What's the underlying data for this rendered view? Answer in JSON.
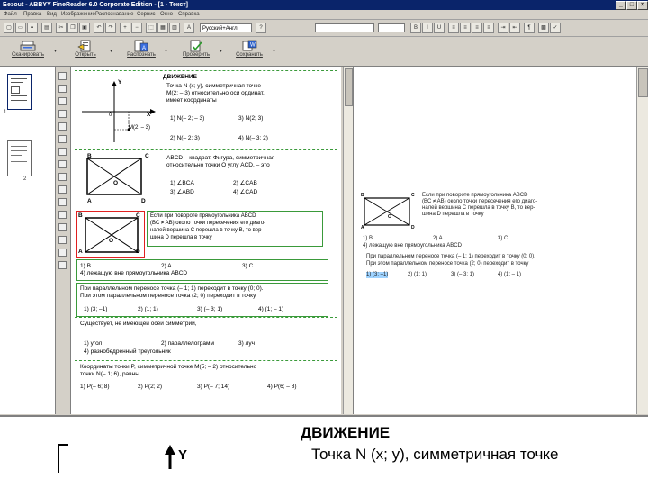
{
  "window": {
    "title": "Безout - ABBYY FineReader 6.0 Corporate Edition - [1 - Текст]",
    "min": "_",
    "max": "□",
    "close": "×"
  },
  "menu": [
    "Файл",
    "Правка",
    "Вид",
    "Изображение",
    "Распознавание",
    "Сервис",
    "Окно",
    "Справка"
  ],
  "toolbar": {
    "style_combo": "Русский+Англ.",
    "font_combo": "",
    "size_combo": "",
    "pilcrow": "¶"
  },
  "bigbuttons": [
    {
      "label": "Сканировать"
    },
    {
      "label": "Открыть"
    },
    {
      "label": "Распознать"
    },
    {
      "label": "Проверить"
    },
    {
      "label": "Сохранить"
    }
  ],
  "thumbs": [
    {
      "num": "1"
    },
    {
      "num": "2"
    }
  ],
  "image": {
    "heading": "ДВИЖЕНИЕ",
    "q1_line1": "Точка N (x; y), симметричная точке",
    "q1_line2": "M(2; – 3) относительно оси ординат,",
    "q1_line3": "имеет координаты",
    "q1_a1": "1) N(– 2; – 3)",
    "q1_a2": "3) N(2; 3)",
    "q1_a3": "2) N(– 2; 3)",
    "q1_a4": "4) N(– 3; 2)",
    "axis_y": "Y",
    "axis_x": "X",
    "m_label": "M(2; – 3)",
    "zero": "0",
    "q2_line1": "ABCD – квадрат. Фигура, симметричная",
    "q2_line2": "относительно точки О углу ACD, – это",
    "q2_a1": "1) ∠BCA",
    "q2_a2": "2) ∠CAB",
    "q2_a3": "3) ∠ABD",
    "q2_a4": "4) ∠CAD",
    "pt_A": "A",
    "pt_B": "B",
    "pt_C": "C",
    "pt_D": "D",
    "pt_O": "O",
    "q3_line1": "Если при повороте прямоугольника ABCD",
    "q3_line2": "(BC ≠ AB) около точки пересечения его диаго-",
    "q3_line3": "налей вершина C перешла в точку B, то вер-",
    "q3_line4": "шина D перешла в точку",
    "q3_a1": "1) B",
    "q3_a2": "2) A",
    "q3_a3": "3) C",
    "q3_a4": "4) лежащую вне прямоугольника ABCD",
    "q4_line1": "При параллельном переносе точка (– 1; 1) переходит в точку (0; 0).",
    "q4_line2": "При этом параллельном переносе точка (2; 0) переходит в точку",
    "q4_a1": "1) (3; –1)",
    "q4_a2": "2) (1; 1)",
    "q4_a3": "3) (– 3; 1)",
    "q4_a4": "4) (1; – 1)",
    "q5_line1": "Существует, не имеющей осей симметрии,",
    "q5_a1": "1) угол",
    "q5_a2": "2) параллелограмм",
    "q5_a3": "3) луч",
    "q5_a4": "4) разнобедренный треугольник",
    "q6_line1": "Координаты точки P, симметричной точке M(5; – 2) относительно",
    "q6_line2": "точки N(– 1; 6), равны",
    "q6_a1": "1) P(– 6; 8)",
    "q6_a2": "2) P(2; 2)",
    "q6_a3": "3) P(– 7; 14)",
    "q6_a4": "4) P(6; – 8)"
  },
  "text": {
    "line1": "Если при повороте прямоугольника ABCD",
    "line2": "(BC ≠ AB) около точки пересечения его диаго-",
    "line3": "налей вершина C перешла в точку B, то вер-",
    "line4": "шина D перешла в точку",
    "ans1": "1) B",
    "ans2": "2) A",
    "ans3": "3) C",
    "ans4": "4) лежащую вне прямоугольника ABCD",
    "l5": "При параллельном переносе точка (– 1; 1) переходит в точку (0; 0).",
    "l6": "При этом параллельном переносе точка (2; 0) переходит в точку",
    "l7a": "1) (3; –1)",
    "l7b": "2) (1; 1)",
    "l7c": "3) (– 3; 1)",
    "l7d": "4) (1; – 1)"
  },
  "zoom": {
    "heading": "ДВИЖЕНИЕ",
    "line1": "Точка N (x; y), симметричная точке",
    "axis_y": "Y"
  }
}
